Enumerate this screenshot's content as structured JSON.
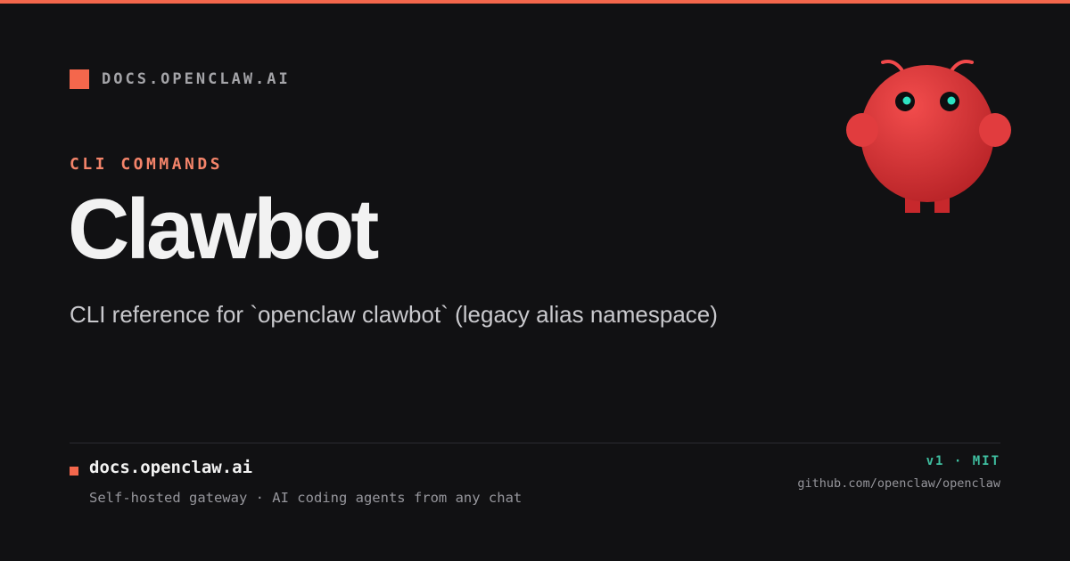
{
  "site": {
    "label": "DOCS.OPENCLAW.AI"
  },
  "header": {
    "section": "CLI COMMANDS",
    "title": "Clawbot",
    "subtitle": "CLI reference for `openclaw clawbot` (legacy alias namespace)"
  },
  "footer": {
    "domain": "docs.openclaw.ai",
    "tagline": "Self-hosted gateway · AI coding agents from any chat",
    "version": "v1 · MIT",
    "repo": "github.com/openclaw/openclaw"
  },
  "mascot": {
    "icon": "lobster-mascot-icon"
  },
  "colors": {
    "accent": "#f4674c",
    "background": "#111113",
    "title": "#f2f2f2",
    "teal": "#3fbfa0"
  }
}
